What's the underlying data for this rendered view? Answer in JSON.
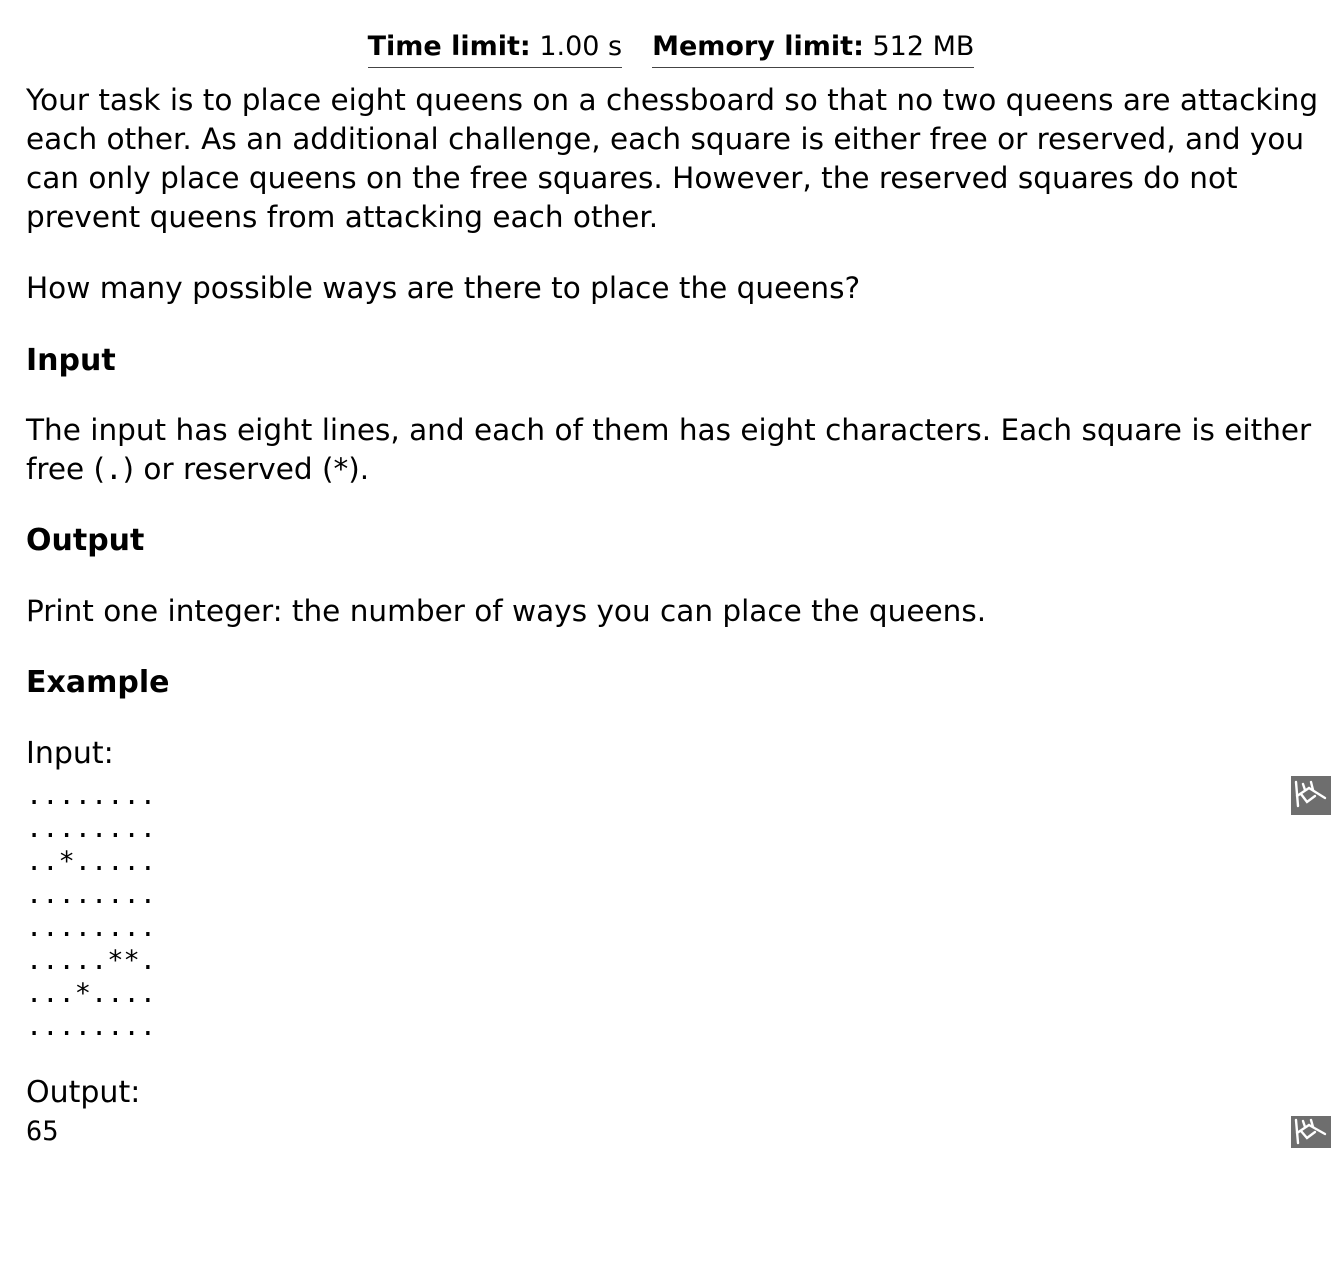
{
  "limits": {
    "time_label": "Time limit:",
    "time_value": "1.00 s",
    "memory_label": "Memory limit:",
    "memory_value": "512 MB"
  },
  "statement": {
    "paragraph1": "Your task is to place eight queens on a chessboard so that no two queens are attacking each other. As an additional challenge, each square is either free or reserved, and you can only place queens on the free squares. However, the reserved squares do not prevent queens from attacking each other.",
    "paragraph2": "How many possible ways are there to place the queens?"
  },
  "input_section": {
    "heading": "Input",
    "text_before": "The input has eight lines, and each of them has eight characters. Each square is either free (",
    "free_char": ".",
    "text_middle": ") or reserved (",
    "reserved_char": "*",
    "text_after": ")."
  },
  "output_section": {
    "heading": "Output",
    "text": "Print one integer: the number of ways you can place the queens."
  },
  "example": {
    "heading": "Example",
    "input_label": "Input:",
    "input_lines": "........\n........\n..*.....\n........\n........\n.....**.\n...*....\n........",
    "output_label": "Output:",
    "output_value": "65",
    "copy_icon": "copy-icon"
  }
}
